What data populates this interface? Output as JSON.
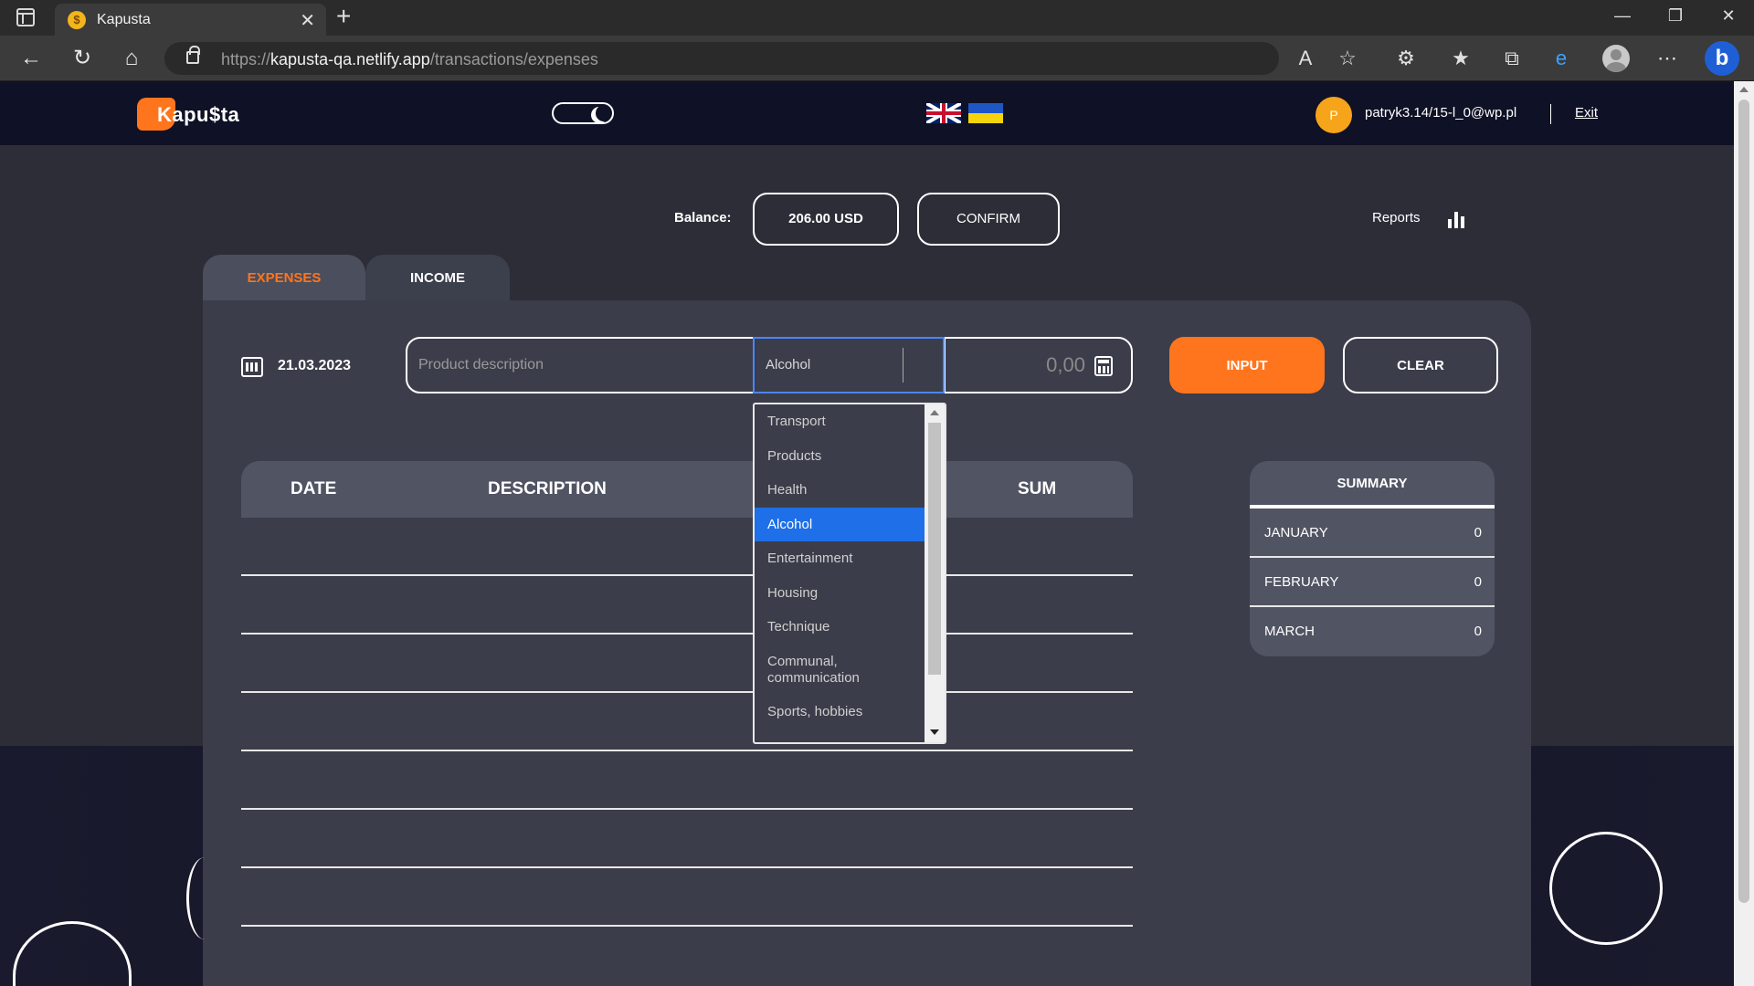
{
  "browser": {
    "tab_title": "Kapusta",
    "favicon_glyph": "$",
    "url_prefix": "https://",
    "url_host": "kapusta-qa.netlify.app",
    "url_path": "/transactions/expenses"
  },
  "header": {
    "logo_text": "Kapu$ta",
    "avatar_letter": "P",
    "user_email": "patryk3.14/15-l_0@wp.pl",
    "exit_label": "Exit"
  },
  "balance": {
    "label": "Balance:",
    "value": "206.00 USD",
    "confirm_label": "CONFIRM",
    "reports_label": "Reports"
  },
  "tabs": [
    {
      "label": "EXPENSES",
      "active": true
    },
    {
      "label": "INCOME",
      "active": false
    }
  ],
  "form": {
    "date": "21.03.2023",
    "description_placeholder": "Product description",
    "category_value": "Alcohol",
    "sum_placeholder": "0,00",
    "input_label": "INPUT",
    "clear_label": "CLEAR"
  },
  "table": {
    "columns": [
      "DATE",
      "DESCRIPTION",
      "SUM"
    ],
    "rows": []
  },
  "summary": {
    "title": "SUMMARY",
    "months": [
      {
        "month": "JANUARY",
        "value": "0"
      },
      {
        "month": "FEBRUARY",
        "value": "0"
      },
      {
        "month": "MARCH",
        "value": "0"
      }
    ]
  },
  "category_options": [
    "Transport",
    "Products",
    "Health",
    "Alcohol",
    "Entertainment",
    "Housing",
    "Technique",
    "Communal, communication",
    "Sports, hobbies"
  ],
  "colors": {
    "accent": "#ff751d",
    "selected_option": "#1e6fe8",
    "card": "#3b3d4a",
    "header_bg": "#0f1126"
  }
}
